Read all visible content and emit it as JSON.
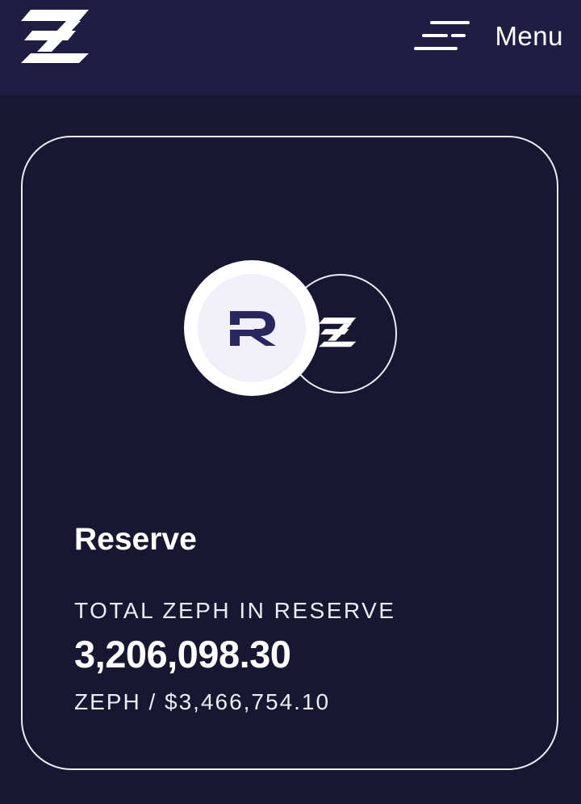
{
  "header": {
    "logo_icon": "zephyr-z-logo-icon",
    "menu_icon": "hamburger-menu-icon",
    "menu_label": "Menu"
  },
  "card": {
    "coin_primary_icon": "reserve-r-coin-icon",
    "coin_secondary_icon": "zeph-z-coin-icon",
    "title": "Reserve",
    "reserve_label": "TOTAL ZEPH IN RESERVE",
    "reserve_value": "3,206,098.30",
    "reserve_sub": "ZEPH / $3,466,754.10"
  },
  "colors": {
    "background": "#181732",
    "header": "#1f1e42",
    "text": "#ffffff",
    "accent": "#2a2660"
  }
}
